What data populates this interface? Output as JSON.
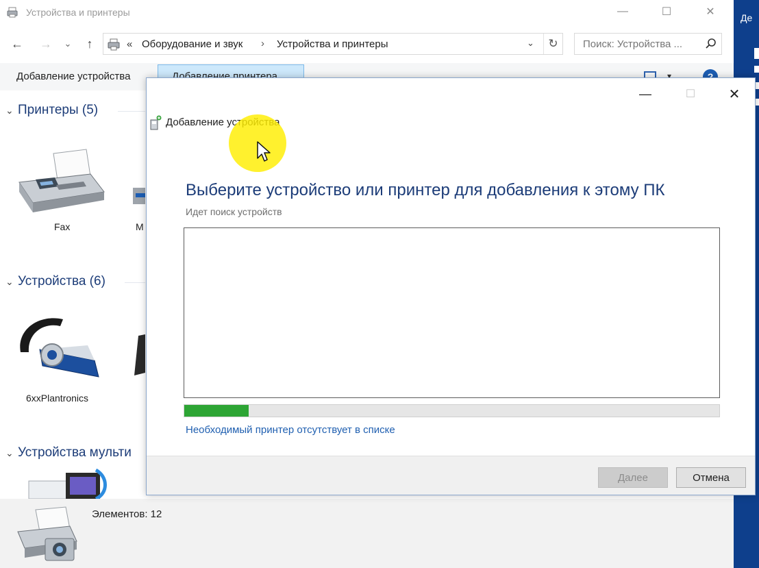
{
  "explorer": {
    "title": "Устройства и принтеры",
    "caption": {
      "minimize": "—",
      "maximize": "☐",
      "close": "✕"
    },
    "nav": {
      "back": "←",
      "forward": "→",
      "recent": "⌄",
      "up": "↑",
      "address_prefix": "«",
      "breadcrumbs": [
        "Оборудование и звук",
        "Устройства и принтеры"
      ],
      "crumb_separator": "›",
      "dropdown": "⌄",
      "refresh": "↻",
      "search_placeholder": "Поиск: Устройства ..."
    },
    "commands": {
      "add_device": "Добавление устройства",
      "add_printer": "Добавление принтера",
      "view_dropdown": "▾",
      "help": "?"
    },
    "groups": [
      {
        "label": "Принтеры (5)",
        "devices": [
          "Fax",
          "M"
        ]
      },
      {
        "label": "Устройства (6)",
        "devices": [
          "6xxPlantronics"
        ]
      },
      {
        "label": "Устройства мульти",
        "devices": []
      }
    ],
    "status": "Элементов: 12"
  },
  "desktop": {
    "label": "Де"
  },
  "dialog": {
    "caption": {
      "minimize": "—",
      "maximize": "☐",
      "close": "✕"
    },
    "title": "Добавление устройства",
    "heading": "Выберите устройство или принтер для добавления к этому ПК",
    "subtitle": "Идет поиск устройств",
    "progress": 0.12,
    "progress_color": "#2da534",
    "missing_printer_link": "Необходимый принтер отсутствует в списке",
    "next_button": "Далее",
    "cancel_button": "Отмена"
  },
  "icons": {
    "explorer_title": "devices-printers-icon",
    "address": "devices-printers-icon",
    "search": "search-icon",
    "dialog_title": "add-device-icon",
    "cursor": "mouse-pointer-icon"
  },
  "colors": {
    "heading": "#1c3c78",
    "link": "#1f5fb0",
    "selected_command": "#cde8fb",
    "cursor_highlight": "#ffee00"
  }
}
